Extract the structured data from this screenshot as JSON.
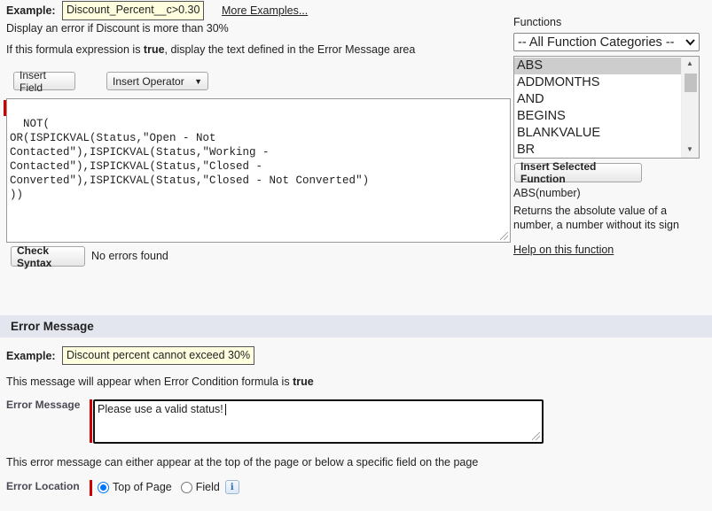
{
  "condition": {
    "example_label": "Example:",
    "example_value": "Discount_Percent__c>0.30",
    "more_examples": "More Examples...",
    "example_desc": "Display an error if Discount is more than 30%",
    "rule_prefix": "If this formula expression is ",
    "rule_bold": "true",
    "rule_suffix": ", display the text defined in the Error Message area",
    "insert_field": "Insert Field",
    "insert_operator": "Insert Operator",
    "formula": "NOT(\nOR(ISPICKVAL(Status,\"Open - Not\nContacted\"),ISPICKVAL(Status,\"Working -\nContacted\"),ISPICKVAL(Status,\"Closed -\nConverted\"),ISPICKVAL(Status,\"Closed - Not Converted\")\n))",
    "check_syntax": "Check Syntax",
    "syntax_status": "No errors found"
  },
  "functions": {
    "heading": "Functions",
    "category_selected": "-- All Function Categories --",
    "items": [
      "ABS",
      "ADDMONTHS",
      "AND",
      "BEGINS",
      "BLANKVALUE",
      "BR"
    ],
    "selected_item": "ABS",
    "insert_button": "Insert Selected Function",
    "signature": "ABS(number)",
    "description": "Returns the absolute value of a number, a number without its sign",
    "help_link": "Help on this function"
  },
  "error_message": {
    "section_title": "Error Message",
    "example_label": "Example:",
    "example_value": "Discount percent cannot exceed 30%",
    "appear_prefix": "This message will appear when Error Condition formula is ",
    "appear_bold": "true",
    "field_label": "Error Message",
    "field_value": "Please use a valid status!",
    "location_desc": "This error message can either appear at the top of the page or below a specific field on the page",
    "location_label": "Error Location",
    "option_top": "Top of Page",
    "option_field": "Field",
    "selected_option": "Top of Page"
  },
  "colors": {
    "required_bar": "#cc0000",
    "example_bg": "#ffffe0",
    "section_bg": "#e3e6ee",
    "radio_accent": "#0075ff"
  },
  "icons": {
    "dropdown": "chevron-down-icon",
    "info": "info-icon"
  }
}
